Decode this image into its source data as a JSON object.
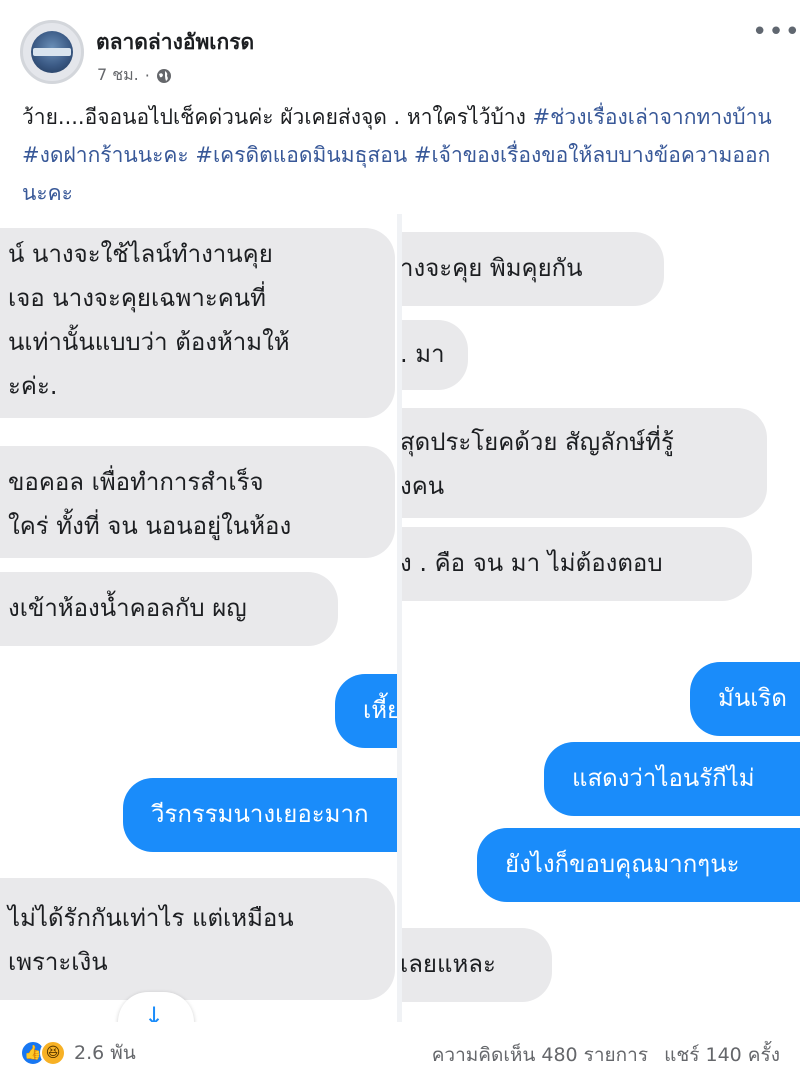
{
  "header": {
    "page_name": "ตลาดล่างอัพเกรด",
    "time": "7 ชม.",
    "privacy_icon": "globe-icon",
    "more_icon": "more-options-icon"
  },
  "caption": {
    "text": "ว้าย....อีจอนอไปเช็คด่วนค่ะ ผัวเคยส่งจุด . หาใครไว้บ้าง ",
    "tags": [
      "#ช่วงเรื่องเล่าจากทางบ้าน",
      "#งดฝากร้านนะคะ",
      "#เครดิตแอดมินมธุสอน",
      "#เจ้าของเรื่องขอให้ลบบางข้อความออกนะคะ"
    ]
  },
  "left_chat": {
    "b1": [
      "น์ นางจะใช้ไลน์ทำงานคุย",
      "เจอ นางจะคุยเฉพาะคนที่",
      "นเท่านั้นแบบว่า ต้องห้ามให้",
      "ะค่ะ."
    ],
    "b2": [
      "ขอคอล เพื่อทำการสำเร็จ",
      "ใคร่ ทั้งที่ จน นอนอยู่ในห้อง"
    ],
    "b3": "งเข้าห้องน้ำคอลกับ ผญ",
    "b4": "เหี้ย",
    "b5": "วีรกรรมนางเยอะมาก",
    "b6": [
      "ไม่ได้รักกันเท่าไร แต่เหมือน",
      "เพราะเงิน"
    ],
    "scroll_icon": "arrow-down-icon"
  },
  "right_chat": {
    "b1": "างจะคุย พิมคุยกัน",
    "b2": ". มา",
    "b3": [
      "สุดประโยคด้วย สัญลักษ์ที่รู้",
      "งคน"
    ],
    "b4": "ง . คือ จน มา ไม่ต้องตอบ",
    "b5": "มันเริด",
    "b6": "แสดงว่าไอนรักีไม่",
    "b7": "ยังไงก็ขอบคุณมากๆนะ",
    "b8": "เลยแหละ"
  },
  "footer": {
    "reaction_icons": [
      "like-icon",
      "haha-icon"
    ],
    "reaction_count": "2.6 พัน",
    "comments": "ความคิดเห็น 480 รายการ",
    "shares": "แชร์ 140 ครั้ง"
  }
}
